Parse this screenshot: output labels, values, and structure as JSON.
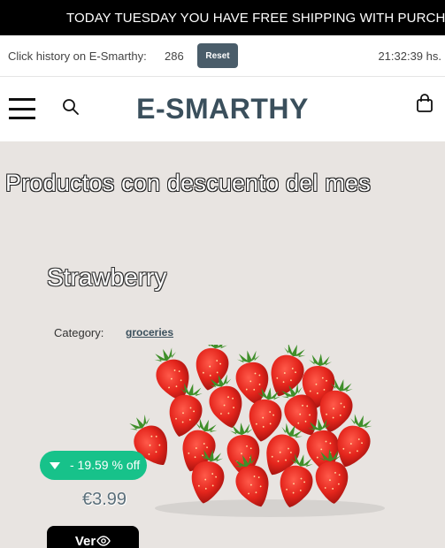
{
  "promo": {
    "text": "TODAY TUESDAY YOU HAVE FREE SHIPPING WITH PURCHASES"
  },
  "history": {
    "label": "Click history on E-Smarthy:",
    "count": "286",
    "reset_label": "Reset",
    "time": "21:32:39 hs."
  },
  "header": {
    "brand": "E-SMARTHY",
    "menu_icon": "hamburger-menu-icon",
    "search_icon": "search-icon",
    "cart_icon": "shopping-bag-icon"
  },
  "section": {
    "title": "Productos con descuento del mes"
  },
  "product": {
    "name": "Strawberry",
    "category_label": "Category:",
    "category": "groceries",
    "discount": "- 19.59 % off",
    "price": "€3.99",
    "view_label": "Ver",
    "view_icon": "eye-icon",
    "discount_icon": "caret-down-icon"
  },
  "colors": {
    "brand": "#3a4f5c",
    "discount_badge": "#17c28a",
    "reset_button": "#4a5d6a",
    "background": "#e8e4e1"
  }
}
